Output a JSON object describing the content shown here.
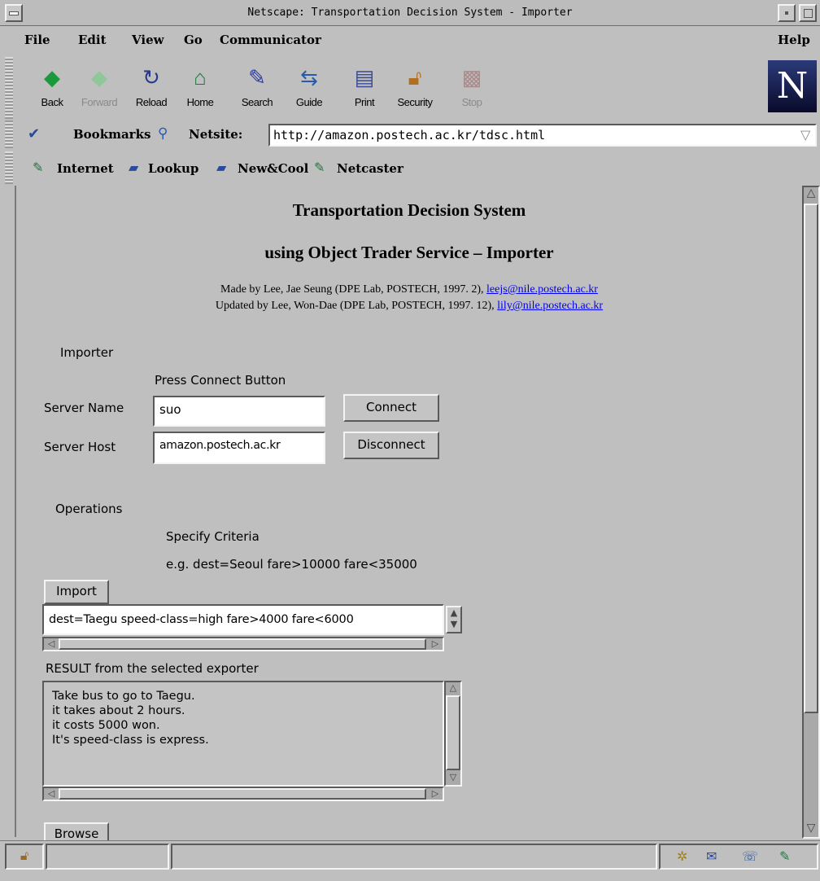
{
  "window": {
    "title": "Netscape: Transportation Decision System - Importer"
  },
  "menu": {
    "file": "File",
    "edit": "Edit",
    "view": "View",
    "go": "Go",
    "communicator": "Communicator",
    "help": "Help"
  },
  "toolbar": {
    "back": "Back",
    "forward": "Forward",
    "reload": "Reload",
    "home": "Home",
    "search": "Search",
    "guide": "Guide",
    "print": "Print",
    "security": "Security",
    "stop": "Stop"
  },
  "location": {
    "bookmarks": "Bookmarks",
    "netsite_label": "Netsite:",
    "url": "http://amazon.postech.ac.kr/tdsc.html"
  },
  "personal": {
    "internet": "Internet",
    "lookup": "Lookup",
    "newcool": "New&Cool",
    "netcaster": "Netcaster"
  },
  "page": {
    "title1": "Transportation Decision System",
    "title2": "using Object Trader Service – Importer",
    "credit1": "Made by Lee, Jae Seung (DPE Lab, POSTECH, 1997. 2), ",
    "credit1_email": "leejs@nile.postech.ac.kr",
    "credit2": "Updated by Lee, Won-Dae (DPE Lab, POSTECH, 1997. 12), ",
    "credit2_email": "lily@nile.postech.ac.kr"
  },
  "applet": {
    "importer_label": "Importer",
    "press_connect": "Press Connect Button",
    "server_name_label": "Server Name",
    "server_name_value": "suo",
    "server_host_label": "Server Host",
    "server_host_value": "amazon.postech.ac.kr",
    "connect": "Connect",
    "disconnect": "Disconnect",
    "operations_label": "Operations",
    "specify_criteria": "Specify Criteria",
    "example": "e.g. dest=Seoul fare>10000 fare<35000",
    "import": "Import",
    "criteria_value": "dest=Taegu speed-class=high fare>4000 fare<6000",
    "result_label": "RESULT  from the selected exporter",
    "result_text": "Take bus to go to Taegu.\nit takes about 2 hours.\nit costs 5000 won.\nIt's speed-class is express.",
    "browse": "Browse"
  }
}
